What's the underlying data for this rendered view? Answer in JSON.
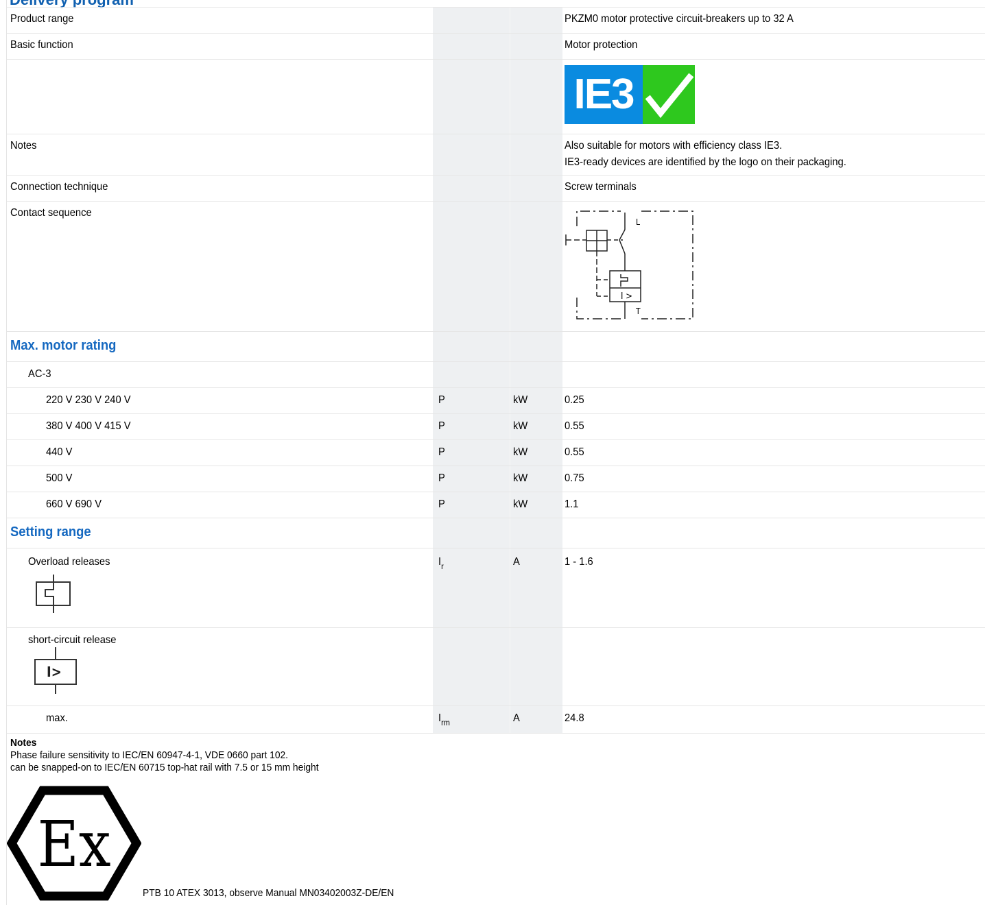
{
  "header_partial": "Delivery program",
  "rows": {
    "product_range": {
      "label": "Product range",
      "value": "PKZM0 motor protective circuit-breakers up to 32 A"
    },
    "basic_function": {
      "label": "Basic function",
      "value": "Motor protection"
    },
    "ie3_logo": {
      "text": "IE3"
    },
    "notes": {
      "label": "Notes",
      "line1": "Also suitable for motors with efficiency class IE3.",
      "line2": "IE3-ready devices are identified by the logo on their packaging."
    },
    "connection": {
      "label": "Connection technique",
      "value": "Screw terminals"
    },
    "contact_sequence": {
      "label": "Contact sequence",
      "label_l": "L",
      "label_t": "T",
      "label_i": "I >"
    }
  },
  "max_motor_rating": {
    "title": "Max. motor rating",
    "category": "AC-3",
    "rows": [
      {
        "voltage": "220 V 230 V 240 V",
        "symbol": "P",
        "unit": "kW",
        "value": "0.25"
      },
      {
        "voltage": "380 V 400 V 415 V",
        "symbol": "P",
        "unit": "kW",
        "value": "0.55"
      },
      {
        "voltage": "440 V",
        "symbol": "P",
        "unit": "kW",
        "value": "0.55"
      },
      {
        "voltage": "500 V",
        "symbol": "P",
        "unit": "kW",
        "value": "0.75"
      },
      {
        "voltage": "660 V 690 V",
        "symbol": "P",
        "unit": "kW",
        "value": "1.1"
      }
    ]
  },
  "setting_range": {
    "title": "Setting range",
    "overload": {
      "label": "Overload releases",
      "symbol": "I",
      "symbol_sub": "r",
      "unit": "A",
      "value": "1 - 1.6"
    },
    "short_circuit": {
      "label": "short-circuit release",
      "symbol_text": "I>"
    },
    "max": {
      "label": "max.",
      "symbol": "I",
      "symbol_sub": "rm",
      "unit": "A",
      "value": "24.8"
    }
  },
  "footer": {
    "title": "Notes",
    "line1": "Phase failure sensitivity to IEC/EN 60947-4-1, VDE 0660 part 102.",
    "line2": "can be snapped-on to IEC/EN 60715 top-hat rail with 7.5 or 15 mm height",
    "ex_text": "Ex",
    "atex": "PTB 10 ATEX 3013, observe Manual MN03402003Z-DE/EN"
  }
}
